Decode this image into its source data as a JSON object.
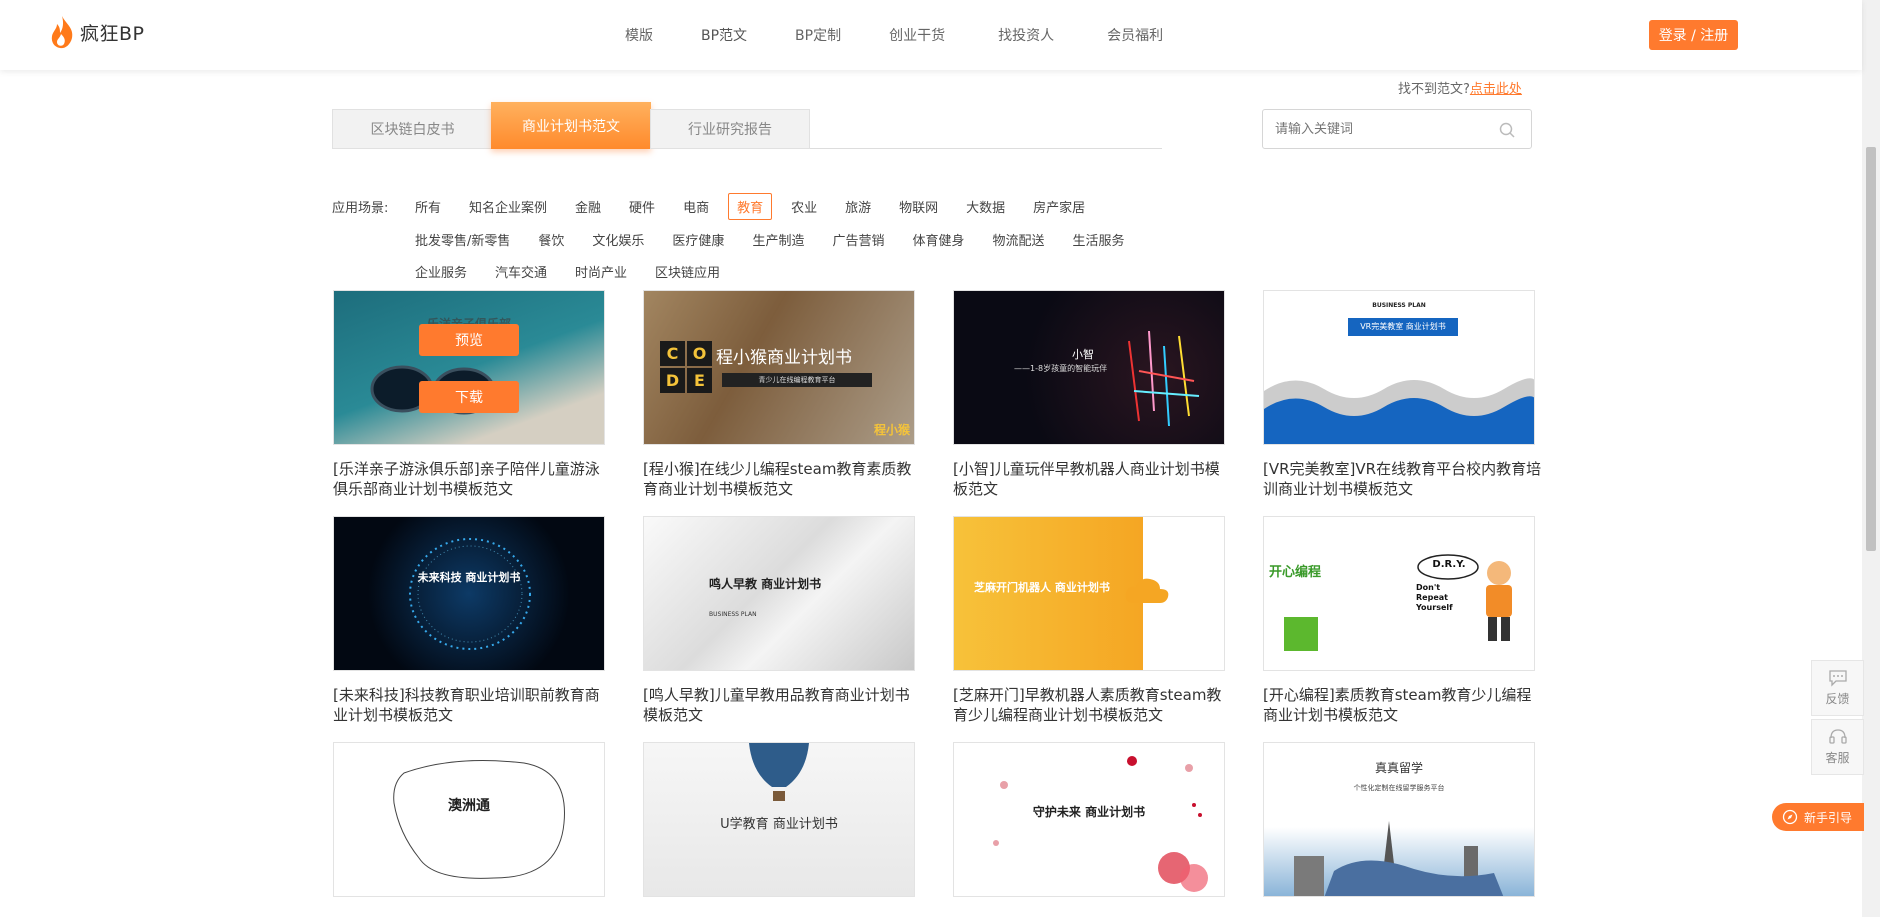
{
  "header": {
    "logo_text": "疯狂BP",
    "nav": [
      "模版",
      "BP范文",
      "BP定制",
      "创业干货",
      "找投资人",
      "会员福利"
    ],
    "login": "登录 / 注册"
  },
  "notfound": {
    "text": "找不到范文?",
    "link": "点击此处"
  },
  "tabs": [
    "区块链白皮书",
    "商业计划书范文",
    "行业研究报告"
  ],
  "search": {
    "placeholder": "请输入关键词"
  },
  "filters": {
    "label": "应用场景:",
    "row1": [
      "所有",
      "知名企业案例",
      "金融",
      "硬件",
      "电商",
      "教育",
      "农业",
      "旅游",
      "物联网",
      "大数据",
      "房产家居"
    ],
    "row2": [
      "批发零售/新零售",
      "餐饮",
      "文化娱乐",
      "医疗健康",
      "生产制造",
      "广告营销",
      "体育健身",
      "物流配送",
      "生活服务"
    ],
    "row3": [
      "企业服务",
      "汽车交通",
      "时尚产业",
      "区块链应用"
    ],
    "active": "教育"
  },
  "hover": {
    "preview": "预览",
    "download": "下载"
  },
  "cards": [
    {
      "title": "[乐洋亲子游泳俱乐部]亲子陪伴儿童游泳俱乐部商业计划书模板范文",
      "thumb_text": "乐洋亲子俱乐部"
    },
    {
      "title": "[程小猴]在线少儿编程steam教育素质教育商业计划书模板范文",
      "thumb_text": "程小猴商业计划书",
      "thumb_sub": "青少儿在线编程教育平台",
      "badge": "程小猴",
      "code": [
        "C",
        "O",
        "D",
        "E"
      ]
    },
    {
      "title": "[小智]儿童玩伴早教机器人商业计划书模板范文",
      "thumb_text": "小智",
      "thumb_sub": "——1-8岁孩童的智能玩伴"
    },
    {
      "title": "[VR完美教室]VR在线教育平台校内教育培训商业计划书模板范文",
      "thumb_text": "VR完美教室 商业计划书",
      "thumb_top": "BUSINESS PLAN"
    },
    {
      "title": "[未来科技]科技教育职业培训职前教育商业计划书模板范文",
      "thumb_text": "未来科技 商业计划书"
    },
    {
      "title": "[鸣人早教]儿童早教用品教育商业计划书模板范文",
      "thumb_text": "鸣人早教 商业计划书",
      "thumb_sub": "BUSINESS PLAN"
    },
    {
      "title": "[芝麻开门]早教机器人素质教育steam教育少儿编程商业计划书模板范文",
      "thumb_text": "芝麻开门机器人 商业计划书"
    },
    {
      "title": "[开心编程]素质教育steam教育少儿编程商业计划书模板范文",
      "thumb_text": "开心编程",
      "thumb_sub": "D.R.Y.",
      "thumb_sub2": "Don't Repeat Yourself"
    },
    {
      "title": "",
      "thumb_text": "澳洲通"
    },
    {
      "title": "",
      "thumb_text": "U学教育 商业计划书"
    },
    {
      "title": "",
      "thumb_text": "守护未来 商业计划书"
    },
    {
      "title": "",
      "thumb_text": "真真留学",
      "thumb_sub": "个性化定制在线留学服务平台"
    }
  ],
  "side": {
    "feedback": "反馈",
    "service": "客服",
    "guide": "新手引导"
  },
  "colors": {
    "accent": "#ff7a2e"
  }
}
